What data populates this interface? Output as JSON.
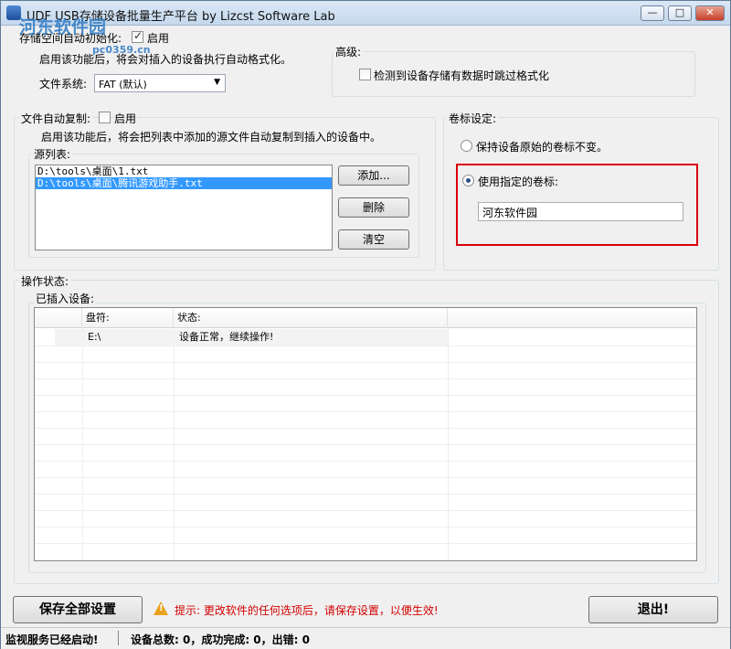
{
  "window": {
    "title": "UDF USB存储设备批量生产平台   by Lizcst Software Lab",
    "watermark": "河东软件园",
    "watermark_url": "pc0359.cn",
    "min_label": "—",
    "max_label": "□",
    "close_label": "✕"
  },
  "format": {
    "enable_label": "存储空间自动初始化:",
    "enable_checkbox_label": "启用",
    "description": "启用该功能后，将会对插入的设备执行自动格式化。",
    "fs_label": "文件系统:",
    "fs_value": "FAT (默认)"
  },
  "advanced": {
    "title": "高级:",
    "skip_label": "检测到设备存储有数据时跳过格式化"
  },
  "copy": {
    "title": "文件自动复制:",
    "enable_label": "启用",
    "description": "启用该功能后，将会把列表中添加的源文件自动复制到插入的设备中。",
    "source_label": "源列表:",
    "items": [
      "D:\\tools\\桌面\\1.txt",
      "D:\\tools\\桌面\\腾讯游戏助手.txt"
    ],
    "add_label": "添加...",
    "delete_label": "删除",
    "clear_label": "清空"
  },
  "volume": {
    "title": "卷标设定:",
    "keep_label": "保持设备原始的卷标不变。",
    "custom_label": "使用指定的卷标:",
    "custom_value": "河东软件园"
  },
  "status": {
    "title": "操作状态:",
    "devices_label": "已插入设备:",
    "columns": [
      "",
      "盘符:",
      "状态:",
      ""
    ],
    "rows": [
      {
        "drive": "E:\\",
        "state": "设备正常，继续操作!"
      }
    ]
  },
  "footer": {
    "save_label": "保存全部设置",
    "hint": "提示: 更改软件的任何选项后，请保存设置，以便生效!",
    "exit_label": "退出!"
  },
  "statusbar": {
    "service": "监视服务已经启动!",
    "stats": "设备总数: 0，成功完成: 0，出错: 0"
  },
  "colors": {
    "highlight_red": "#d9000d",
    "selection_blue": "#3399ff",
    "hint_red": "#d40000"
  }
}
